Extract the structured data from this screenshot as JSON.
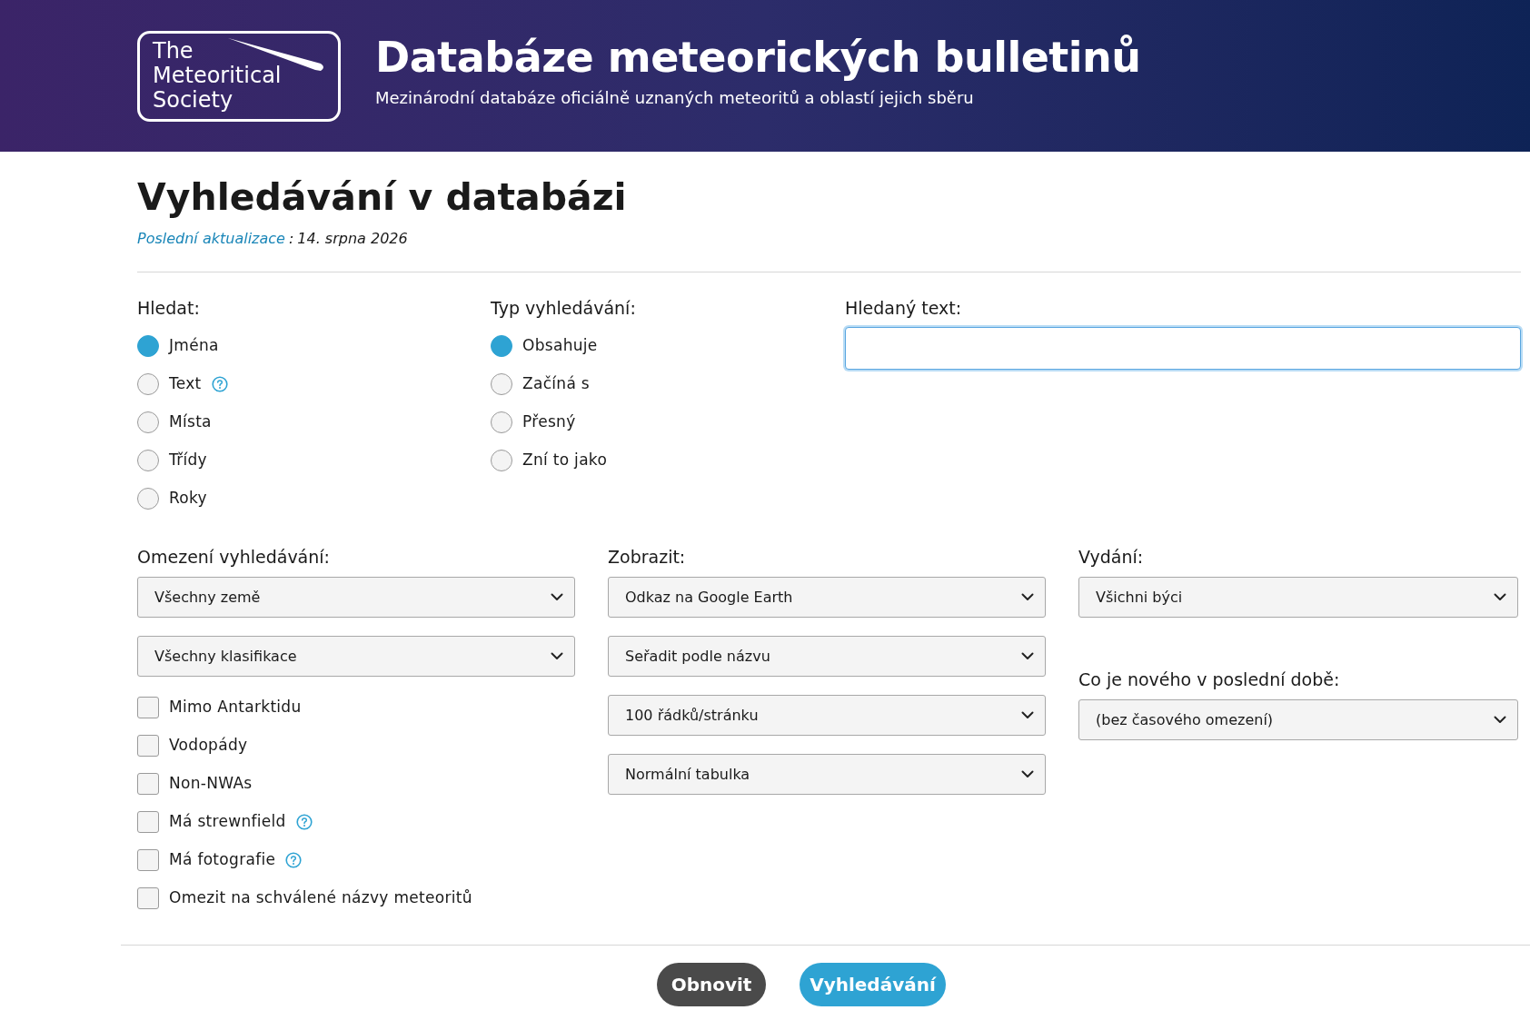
{
  "header": {
    "logo_lines": [
      "The",
      "Meteoritical",
      "Society"
    ],
    "title": "Databáze meteorických bulletinů",
    "subtitle": "Mezinárodní databáze oficiálně uznaných meteoritů a oblastí jejich sběru"
  },
  "page_title": "Vyhledávání v databázi",
  "last_update": {
    "label": "Poslední aktualizace",
    "separator": ":",
    "date": "14. srpna 2026"
  },
  "search_in": {
    "label": "Hledat:",
    "options": [
      {
        "label": "Jména",
        "selected": true,
        "help": false
      },
      {
        "label": "Text",
        "selected": false,
        "help": true
      },
      {
        "label": "Místa",
        "selected": false,
        "help": false
      },
      {
        "label": "Třídy",
        "selected": false,
        "help": false
      },
      {
        "label": "Roky",
        "selected": false,
        "help": false
      }
    ]
  },
  "search_type": {
    "label": "Typ vyhledávání:",
    "options": [
      {
        "label": "Obsahuje",
        "selected": true,
        "help": false
      },
      {
        "label": "Začíná s",
        "selected": false,
        "help": false
      },
      {
        "label": "Přesný",
        "selected": false,
        "help": false
      },
      {
        "label": "Zní to jako",
        "selected": false,
        "help": false
      }
    ]
  },
  "search_text": {
    "label": "Hledaný text:",
    "focused": true
  },
  "limits": {
    "label": "Omezení vyhledávání:",
    "selects": [
      {
        "value": "Všechny země"
      },
      {
        "value": "Všechny klasifikace"
      }
    ],
    "checkboxes": [
      {
        "label": "Mimo Antarktidu",
        "checked": false,
        "help": false
      },
      {
        "label": "Vodopády",
        "checked": false,
        "help": false
      },
      {
        "label": "Non-NWAs",
        "checked": false,
        "help": false
      },
      {
        "label": "Má strewnfield",
        "checked": false,
        "help": true
      },
      {
        "label": "Má fotografie",
        "checked": false,
        "help": true
      },
      {
        "label": "Omezit na schválené názvy meteoritů",
        "checked": false,
        "help": false
      }
    ]
  },
  "display": {
    "label": "Zobrazit:",
    "selects": [
      {
        "value": "Odkaz na Google Earth"
      },
      {
        "value": "Seřadit podle názvu"
      },
      {
        "value": "100 řádků/stránku"
      },
      {
        "value": "Normální tabulka"
      }
    ]
  },
  "edition": {
    "label": "Vydání:",
    "select": {
      "value": "Všichni býci"
    }
  },
  "whats_new": {
    "label": "Co je nového v poslední době:",
    "select": {
      "value": "(bez časového omezení)"
    }
  },
  "buttons": [
    {
      "label": "Obnovit",
      "kind": "secondary"
    },
    {
      "label": "Vyhledávání",
      "kind": "primary"
    }
  ]
}
